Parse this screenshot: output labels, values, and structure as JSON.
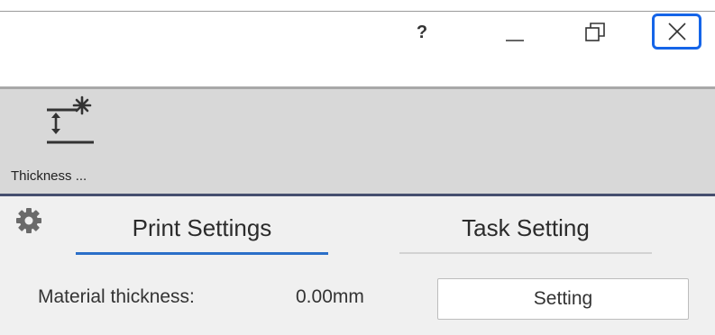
{
  "window": {
    "help_label": "?"
  },
  "toolbar": {
    "thickness_label": "Thickness ..."
  },
  "tabs": [
    {
      "label": "Print Settings",
      "active": true
    },
    {
      "label": "Task Setting",
      "active": false
    }
  ],
  "print_settings": {
    "material_thickness_label": "Material thickness:",
    "material_thickness_value": "0.00mm",
    "setting_button_label": "Setting"
  },
  "colors": {
    "accent": "#2b6fc8",
    "close_highlight": "#1565e8",
    "toolbar_bg": "#d8d8d8",
    "panel_bg": "#f0f0f0"
  },
  "icons": [
    "help-icon",
    "minimize-icon",
    "restore-icon",
    "close-icon",
    "thickness-laser-icon",
    "gear-icon"
  ]
}
